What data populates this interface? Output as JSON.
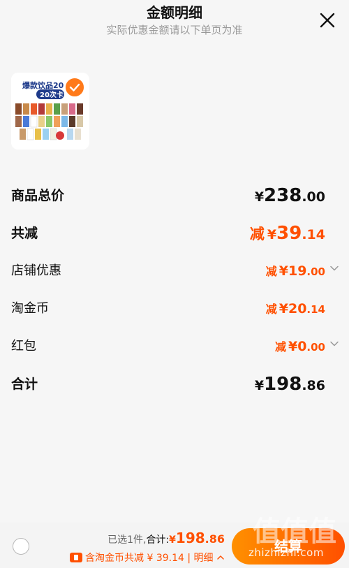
{
  "header": {
    "title": "金额明细",
    "subtitle": "实际优惠金额请以下单页为准"
  },
  "product": {
    "image_text_line1": "爆款饮品20",
    "image_text_line2": "20次卡",
    "selected": true
  },
  "summary": {
    "goods_total": {
      "label": "商品总价",
      "symbol": "¥",
      "int": "238",
      "dec": ".00"
    },
    "total_reduce": {
      "label": "共减",
      "prefix": "减",
      "symbol": "¥",
      "int": "39",
      "dec": ".14"
    },
    "shop_discount": {
      "label": "店铺优惠",
      "prefix": "减",
      "symbol": "¥",
      "int": "19",
      "dec": ".00"
    },
    "taojinbi": {
      "label": "淘金币",
      "prefix": "减",
      "symbol": "¥",
      "int": "20",
      "dec": ".14"
    },
    "red_packet": {
      "label": "红包",
      "prefix": "减",
      "symbol": "¥",
      "int": "0",
      "dec": ".00"
    },
    "grand_total": {
      "label": "合计",
      "symbol": "¥",
      "int": "198",
      "dec": ".86"
    }
  },
  "footer": {
    "selected_text": "已选1件,",
    "total_label": "合计:",
    "total_symbol": "¥",
    "total_int": "198",
    "total_dec": ".86",
    "coin_text": "含淘金币共减 ¥ 39.14 | 明细",
    "checkout_label": "结算"
  },
  "watermark": {
    "text": "zhizhizhi.com",
    "mark": "值值值"
  },
  "colors": {
    "accent": "#ff5000",
    "accent_light": "#ff9000",
    "text": "#111111",
    "muted": "#999999"
  }
}
